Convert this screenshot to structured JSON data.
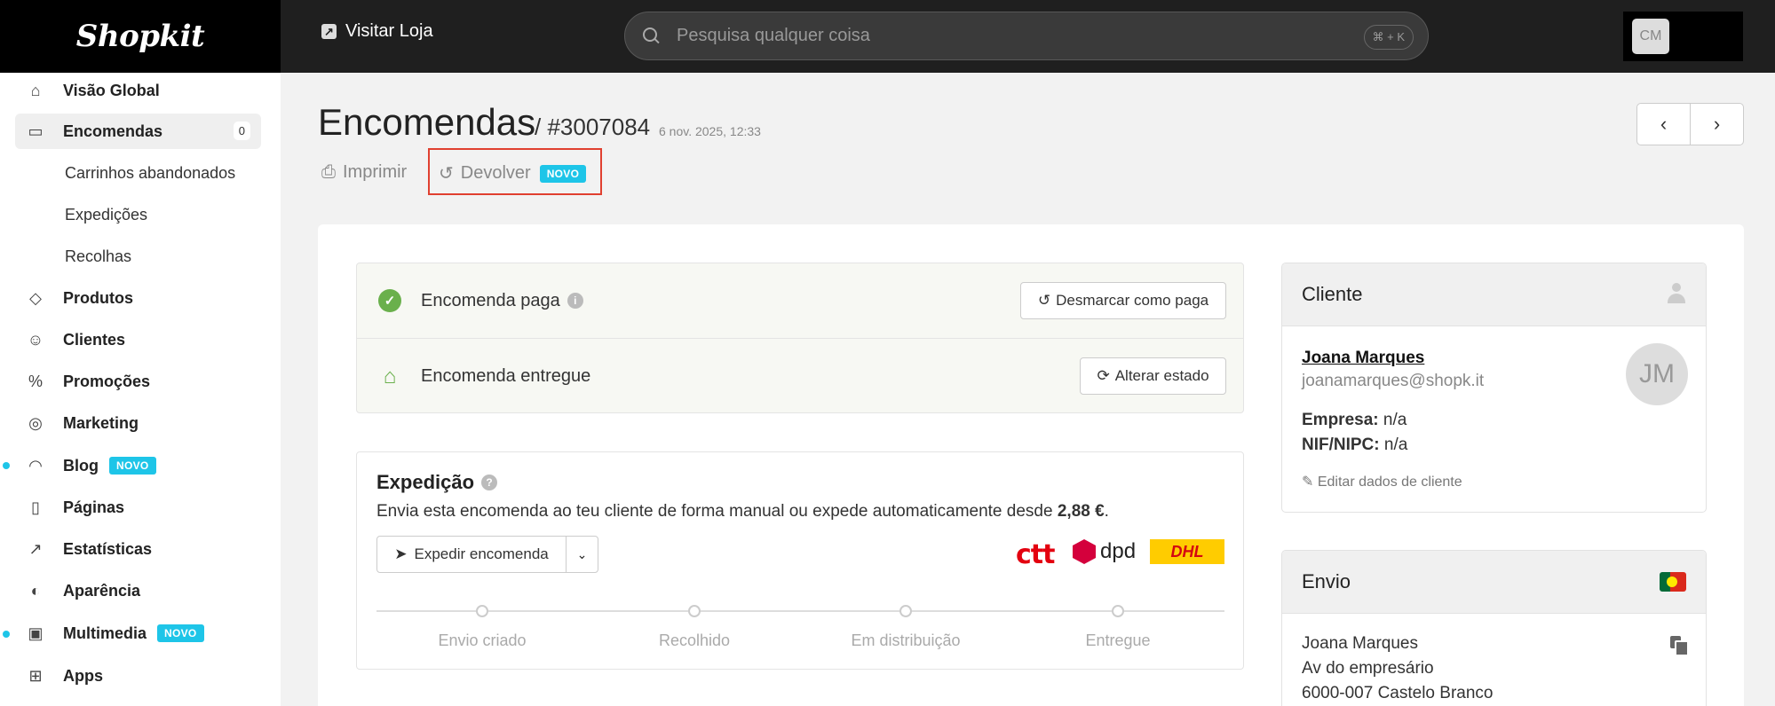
{
  "app": {
    "logo": "Shopkit"
  },
  "topbar": {
    "visit_store": "Visitar Loja",
    "search_placeholder": "Pesquisa qualquer coisa",
    "search_shortcut": "⌘ + K",
    "user_initials": "CM"
  },
  "sidebar": {
    "items": [
      {
        "label": "Visão Global",
        "icon": "home-icon"
      },
      {
        "label": "Encomendas",
        "icon": "inbox-icon",
        "count": "0",
        "active": true
      },
      {
        "label": "Produtos",
        "icon": "tag-icon"
      },
      {
        "label": "Clientes",
        "icon": "users-icon"
      },
      {
        "label": "Promoções",
        "icon": "discount-icon"
      },
      {
        "label": "Marketing",
        "icon": "target-icon"
      },
      {
        "label": "Blog",
        "icon": "rss-icon",
        "badge": "NOVO"
      },
      {
        "label": "Páginas",
        "icon": "page-icon"
      },
      {
        "label": "Estatísticas",
        "icon": "chart-icon"
      },
      {
        "label": "Aparência",
        "icon": "palette-icon"
      },
      {
        "label": "Multimedia",
        "icon": "images-icon",
        "badge": "NOVO"
      },
      {
        "label": "Apps",
        "icon": "apps-icon"
      }
    ],
    "subitems": [
      "Carrinhos abandonados",
      "Expedições",
      "Recolhas"
    ]
  },
  "header": {
    "title": "Encomendas",
    "order_number": "/ #3007084",
    "order_date": "6 nov. 2025, 12:33",
    "actions": {
      "print": "Imprimir",
      "return": "Devolver",
      "return_badge": "NOVO"
    }
  },
  "status": {
    "paid": "Encomenda paga",
    "unmark_paid": "Desmarcar como paga",
    "delivered": "Encomenda entregue",
    "change_state": "Alterar estado"
  },
  "shipping": {
    "title": "Expedição",
    "description_prefix": "Envia esta encomenda ao teu cliente de forma manual ou expede automaticamente desde",
    "price": "2,88 €",
    "description_suffix": ".",
    "ship_button": "Expedir encomenda",
    "carriers": [
      "ctt",
      "dpd",
      "DHL"
    ],
    "steps": [
      "Envio criado",
      "Recolhido",
      "Em distribuição",
      "Entregue"
    ]
  },
  "customer": {
    "title": "Cliente",
    "name": "Joana Marques",
    "email": "joanamarques@shopk.it",
    "company_label": "Empresa:",
    "company_value": "n/a",
    "nif_label": "NIF/NIPC:",
    "nif_value": "n/a",
    "edit": "Editar dados de cliente",
    "initials": "JM"
  },
  "delivery": {
    "title": "Envio",
    "address_lines": [
      "Joana Marques",
      "Av do empresário",
      "6000-007 Castelo Branco"
    ]
  },
  "colors": {
    "accent": "#1ec5e8",
    "success": "#6ab04c",
    "highlight": "#e04030"
  }
}
